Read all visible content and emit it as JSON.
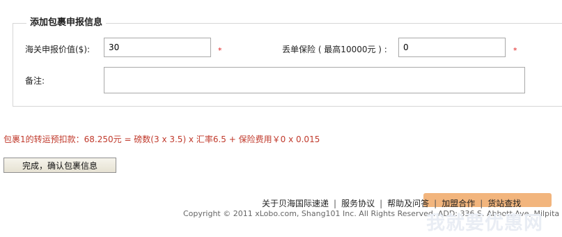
{
  "form": {
    "legend": "添加包裹申报信息",
    "declared_value_label": "海关申报价值($):",
    "declared_value": "30",
    "insurance_label": "丢单保险 ( 最高10000元 ) :",
    "insurance_value": "0",
    "remark_label": "备注:",
    "remark_value": "",
    "required_mark": "*"
  },
  "summary": "包裹1的转运预扣款：68.250元 = 磅数(3 x 3.5) x 汇率6.5 + 保险费用￥0 x 0.015",
  "confirm_button": "完成，确认包裹信息",
  "footer": {
    "links": [
      "关于贝海国际速递",
      "服务协议",
      "帮助及问答",
      "加盟合作",
      "货站查找"
    ],
    "separator": "|",
    "copyright": "Copyright © 2011 xLobo.com, Shang101 Inc. All Rights Reserved. ADD: 336 S. Abbott Ave, Milpita"
  },
  "watermark": {
    "top_text": "www.52zhy.com",
    "bottom_text": "我就要优惠网",
    "band_color": "#f0a866"
  }
}
